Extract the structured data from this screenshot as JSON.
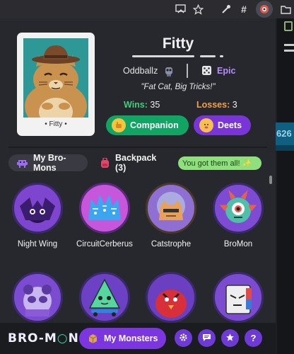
{
  "browser": {
    "icons": [
      "cast-icon",
      "star-icon",
      "eyedropper-icon",
      "hashtag-icon",
      "bromon-extension-icon",
      "folder-icon"
    ]
  },
  "background_page": {
    "number_fragment": "626"
  },
  "monster": {
    "card_name": "• Fitty •",
    "name": "Fitty",
    "developer": "Oddballz",
    "rarity": "Epic",
    "tagline": "\"Fat Cat, Big Tricks!\"",
    "wins_label": "Wins:",
    "wins_value": "35",
    "losses_label": "Losses:",
    "losses_value": "3"
  },
  "actions": {
    "companion_label": "Companion",
    "deets_label": "Deets"
  },
  "tabs": {
    "my_bromons_label": "My Bro-Mons",
    "backpack_label": "Backpack (3)",
    "completion_badge": "You got them all! ✨"
  },
  "collection": [
    {
      "name": "Night Wing"
    },
    {
      "name": "CircuitCerberus"
    },
    {
      "name": "Catstrophe"
    },
    {
      "name": "BroMon"
    },
    {
      "name": ""
    },
    {
      "name": ""
    },
    {
      "name": ""
    },
    {
      "name": ""
    }
  ],
  "footer": {
    "logo_part1": "BRO-M",
    "logo_part2": "N",
    "my_monsters_label": "My Monsters",
    "help_label": "?"
  },
  "colors": {
    "accent_purple": "#7b36e0",
    "companion_green": "#10a562",
    "wins_green": "#3fd07a",
    "losses_orange": "#f2a24a",
    "rarity_purple": "#b88cff",
    "badge_green": "#8fe07d"
  }
}
